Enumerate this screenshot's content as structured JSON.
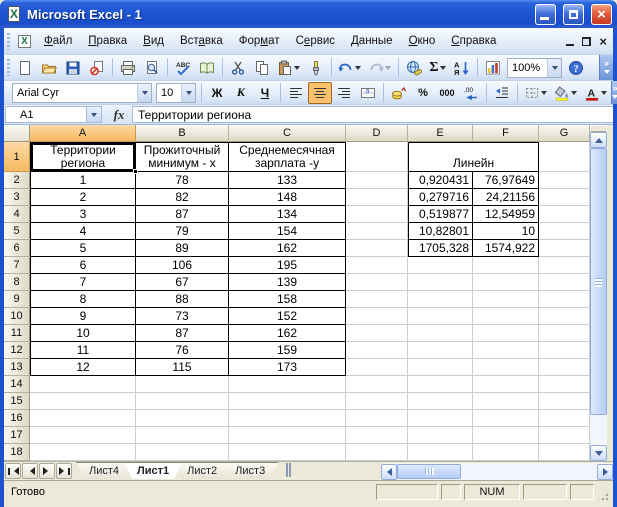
{
  "window": {
    "title": "Microsoft Excel - 1"
  },
  "menu_bar": {
    "items": [
      {
        "label": "Файл",
        "accel": 0
      },
      {
        "label": "Правка",
        "accel": 0
      },
      {
        "label": "Вид",
        "accel": 0
      },
      {
        "label": "Вставка",
        "accel": 3
      },
      {
        "label": "Формат",
        "accel": 3
      },
      {
        "label": "Сервис",
        "accel": 1
      },
      {
        "label": "Данные",
        "accel": 0
      },
      {
        "label": "Окно",
        "accel": 0
      },
      {
        "label": "Справка",
        "accel": 0
      }
    ]
  },
  "standard_toolbar": {
    "items": [
      {
        "name": "new-document"
      },
      {
        "name": "open"
      },
      {
        "name": "save"
      },
      {
        "name": "permission"
      },
      {
        "name": "sep"
      },
      {
        "name": "print"
      },
      {
        "name": "print-preview"
      },
      {
        "name": "sep"
      },
      {
        "name": "spelling"
      },
      {
        "name": "research"
      },
      {
        "name": "sep"
      },
      {
        "name": "cut"
      },
      {
        "name": "copy"
      },
      {
        "name": "paste",
        "dropdown": true
      },
      {
        "name": "format-painter"
      },
      {
        "name": "sep"
      },
      {
        "name": "undo",
        "dropdown": true
      },
      {
        "name": "redo",
        "dropdown": true,
        "disabled": true
      },
      {
        "name": "sep"
      },
      {
        "name": "insert-hyperlink"
      },
      {
        "name": "autosum",
        "label": "Σ",
        "dropdown": true
      },
      {
        "name": "sort-ascending"
      },
      {
        "name": "sep"
      },
      {
        "name": "chart-wizard"
      },
      {
        "name": "zoom",
        "type": "combo",
        "value": "100%"
      },
      {
        "name": "help"
      }
    ]
  },
  "formatting_toolbar": {
    "items": [
      {
        "name": "font-name",
        "type": "combo",
        "value": "Arial Cyr"
      },
      {
        "name": "font-size",
        "type": "combo",
        "value": "10"
      },
      {
        "name": "sep"
      },
      {
        "name": "bold",
        "label": "Ж"
      },
      {
        "name": "italic",
        "label": "К"
      },
      {
        "name": "underline",
        "label": "Ч"
      },
      {
        "name": "sep"
      },
      {
        "name": "align-left"
      },
      {
        "name": "align-center",
        "active": true
      },
      {
        "name": "align-right"
      },
      {
        "name": "merge-center"
      },
      {
        "name": "sep"
      },
      {
        "name": "currency"
      },
      {
        "name": "percent",
        "label": "%"
      },
      {
        "name": "thousands",
        "label": "000"
      },
      {
        "name": "increase-decimal"
      },
      {
        "name": "sep"
      },
      {
        "name": "decrease-indent"
      },
      {
        "name": "sep"
      },
      {
        "name": "borders",
        "dropdown": true
      },
      {
        "name": "fill-color",
        "dropdown": true
      },
      {
        "name": "font-color",
        "dropdown": true
      }
    ]
  },
  "formula_bar": {
    "cell_ref": "A1",
    "fx_label": "fx",
    "value": "Территории региона"
  },
  "worksheet": {
    "columns": [
      "A",
      "B",
      "C",
      "D",
      "E",
      "F",
      "G"
    ],
    "row_count": 18,
    "selected_cell": "A1",
    "main_table": {
      "start_cell": "A1",
      "headers": [
        "Территории региона",
        "Прожиточный минимум - x",
        "Среднемесячная зарплата -y"
      ],
      "rows": [
        [
          "1",
          "78",
          "133"
        ],
        [
          "2",
          "82",
          "148"
        ],
        [
          "3",
          "87",
          "134"
        ],
        [
          "4",
          "79",
          "154"
        ],
        [
          "5",
          "89",
          "162"
        ],
        [
          "6",
          "106",
          "195"
        ],
        [
          "7",
          "67",
          "139"
        ],
        [
          "8",
          "88",
          "158"
        ],
        [
          "9",
          "73",
          "152"
        ],
        [
          "10",
          "87",
          "162"
        ],
        [
          "11",
          "76",
          "159"
        ],
        [
          "12",
          "115",
          "173"
        ]
      ]
    },
    "linest_table": {
      "start_cell": "E1",
      "title": "Линейн",
      "rows": [
        [
          "0,920431",
          "76,97649"
        ],
        [
          "0,279716",
          "24,21156"
        ],
        [
          "0,519877",
          "12,54959"
        ],
        [
          "10,82801",
          "10"
        ],
        [
          "1705,328",
          "1574,922"
        ]
      ]
    }
  },
  "sheet_tabs": {
    "tabs": [
      {
        "label": "Лист4",
        "active": false
      },
      {
        "label": "Лист1",
        "active": true
      },
      {
        "label": "Лист2",
        "active": false
      },
      {
        "label": "Лист3",
        "active": false
      }
    ]
  },
  "status_bar": {
    "ready_label": "Готово",
    "num_label": "NUM"
  },
  "colors": {
    "title_bar": "#1C52CF",
    "window_border": "#1C52CF",
    "selected_header": "#F6BA62",
    "pressed_button": "#FBC26B",
    "fill_swatch": "#FFFF00",
    "font_color_swatch": "#E00000"
  }
}
